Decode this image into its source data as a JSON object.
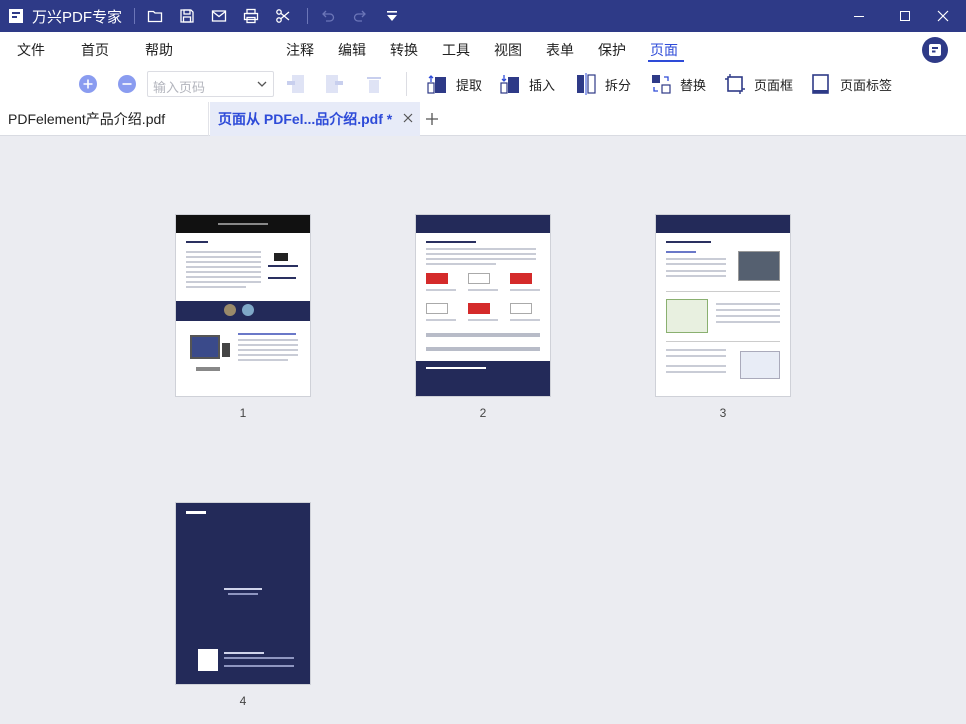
{
  "app": {
    "title": "万兴PDF专家"
  },
  "menu": {
    "items": [
      {
        "label": "文件"
      },
      {
        "label": "首页"
      },
      {
        "label": "帮助"
      },
      {
        "label": "注释"
      },
      {
        "label": "编辑"
      },
      {
        "label": "转换"
      },
      {
        "label": "工具"
      },
      {
        "label": "视图"
      },
      {
        "label": "表单"
      },
      {
        "label": "保护"
      },
      {
        "label": "页面"
      }
    ],
    "active": "页面"
  },
  "toolbar": {
    "page_input_placeholder": "输入页码",
    "extract_label": "提取",
    "insert_label": "插入",
    "split_label": "拆分",
    "replace_label": "替换",
    "page_box_label": "页面框",
    "page_label_label": "页面标签"
  },
  "tabs": [
    {
      "label": "PDFelement产品介绍.pdf",
      "active": false
    },
    {
      "label": "页面从 PDFel...品介绍.pdf *",
      "active": true
    }
  ],
  "pages": [
    {
      "number": "1"
    },
    {
      "number": "2"
    },
    {
      "number": "3"
    },
    {
      "number": "4"
    }
  ],
  "colors": {
    "titlebar": "#2e3a87",
    "accent": "#2e4bd8",
    "content_bg": "#ebecf1"
  }
}
